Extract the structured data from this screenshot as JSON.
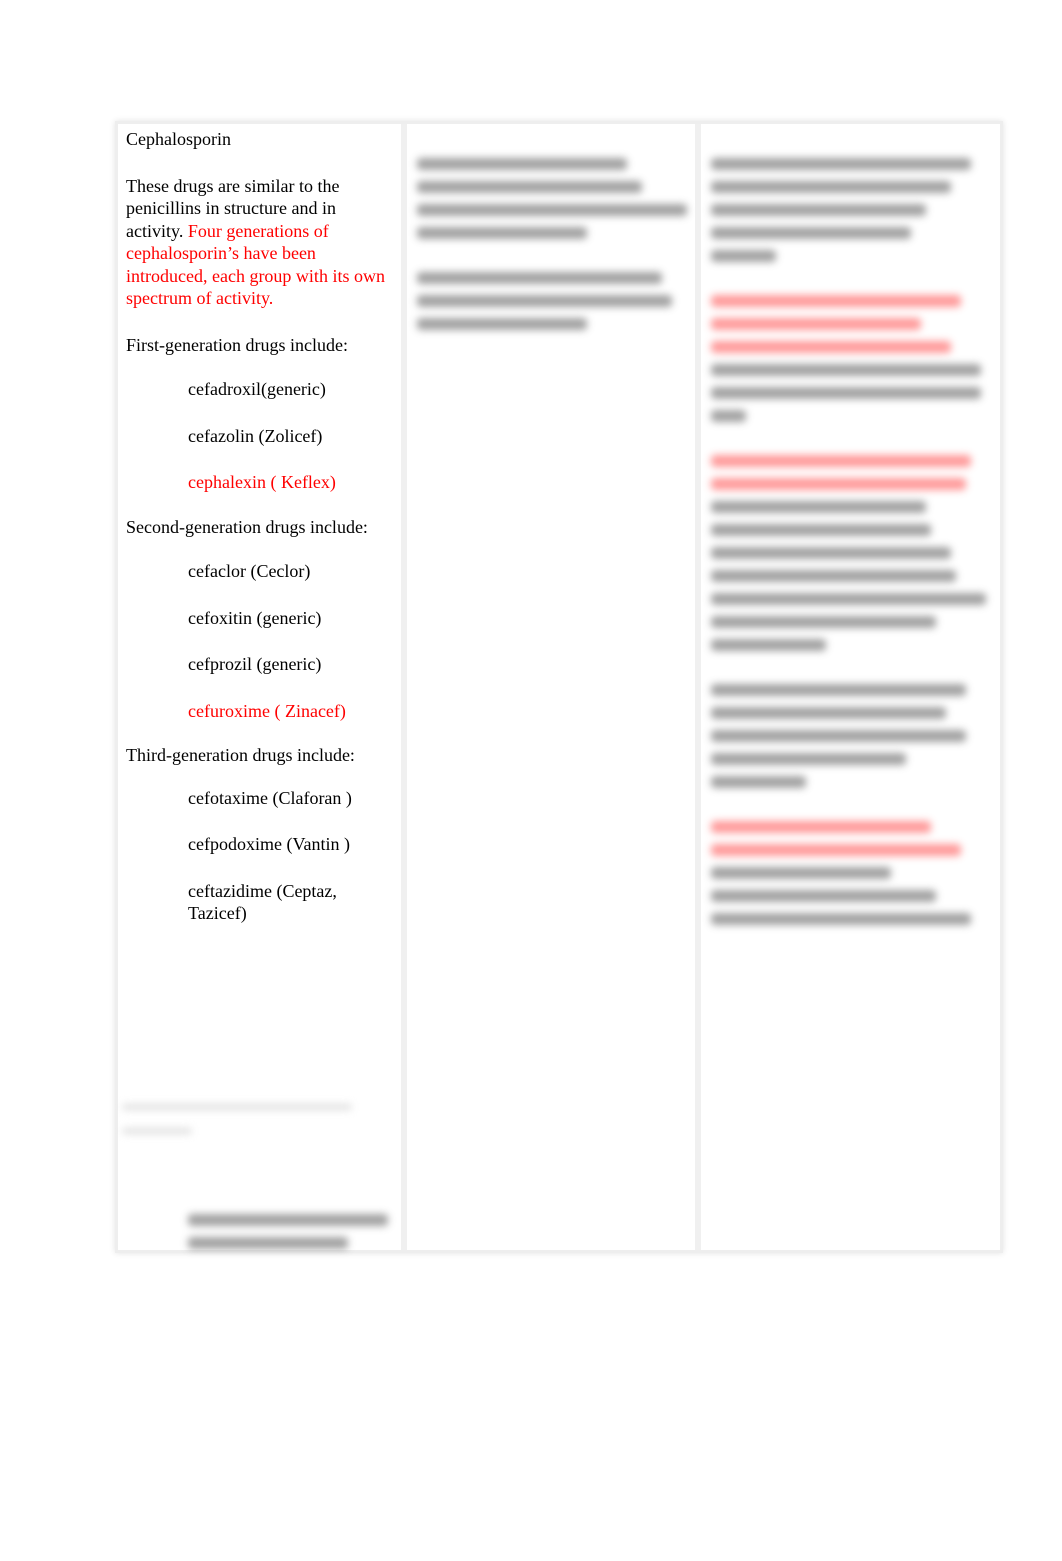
{
  "document": {
    "column1": {
      "title": "Cephalosporin",
      "intro_plain": "These drugs are similar to the penicillins in structure and in activity. ",
      "intro_highlight": "Four generations of cephalosporin’s have been introduced, each group with its own spectrum of activity.",
      "bullet_glyph": "",
      "groups": [
        {
          "heading": "First-generation drugs include:",
          "drugs": [
            {
              "text": "cefadroxil(generic)",
              "highlight": false
            },
            {
              "text": "cefazolin (Zolicef)",
              "highlight": false
            },
            {
              "text": "cephalexin ( Keflex)",
              "highlight": true
            }
          ]
        },
        {
          "heading": "Second-generation drugs include:",
          "drugs": [
            {
              "text": "cefaclor (Ceclor)",
              "highlight": false
            },
            {
              "text": "cefoxitin (generic)",
              "highlight": false
            },
            {
              "text": "cefprozil (generic)",
              "highlight": false
            },
            {
              "text": "cefuroxime ( Zinacef)",
              "highlight": true
            }
          ]
        },
        {
          "heading": "Third-generation drugs include:",
          "drugs": [
            {
              "text": "cefotaxime (Claforan )",
              "highlight": false
            },
            {
              "text": "cefpodoxime (Vantin )",
              "highlight": false
            },
            {
              "text": "ceftazidime (Ceptaz, Tazicef)",
              "highlight": false
            }
          ]
        }
      ]
    },
    "column2": {
      "content_state": "blurred"
    },
    "column3": {
      "content_state": "blurred"
    }
  },
  "colors": {
    "highlight": "#ff0000",
    "text": "#000000"
  }
}
